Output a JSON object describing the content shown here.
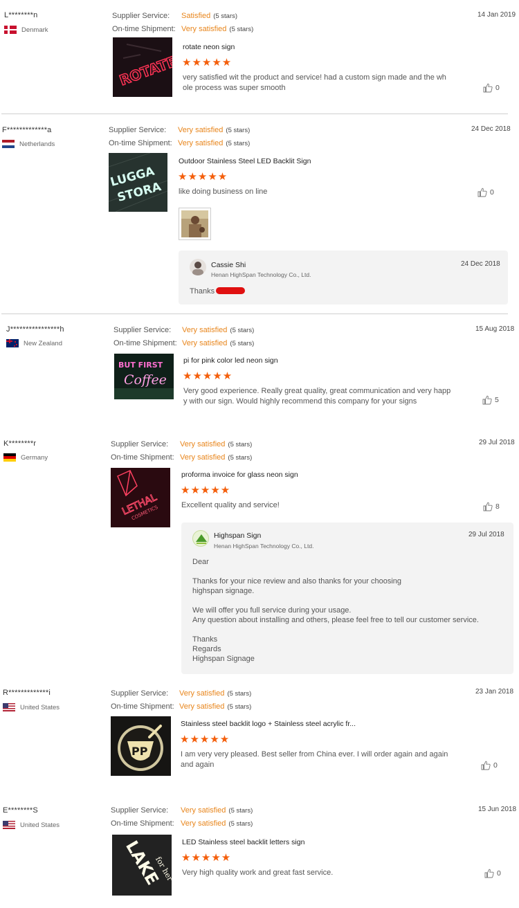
{
  "labels": {
    "supplier_service": "Supplier Service:",
    "ontime_shipment": "On-time Shipment:",
    "stars_note": "(5 stars)"
  },
  "colors": {
    "accent": "#e8851b",
    "star": "#f45f0c",
    "reply_bg": "#f3f3f3"
  },
  "reviews": [
    {
      "user": "L********n",
      "country": "Denmark",
      "flag": "denmark-flag",
      "supplier_rating": "Satisfied",
      "shipment_rating": "Very satisfied",
      "date": "14 Jan 2019",
      "title": "rotate neon sign",
      "stars": "★★★★★",
      "text": "very satisfied wit the product and service! had a custom sign made and the wh ole process was super smooth",
      "likes": "0"
    },
    {
      "user": "F*************a",
      "country": "Netherlands",
      "flag": "netherlands-flag",
      "supplier_rating": "Very satisfied",
      "shipment_rating": "Very satisfied",
      "date": "24 Dec 2018",
      "title": "Outdoor Stainless Steel LED Backlit Sign",
      "stars": "★★★★★",
      "text": "like doing business on line",
      "likes": "0",
      "reply": {
        "name": "Cassie Shi",
        "company": "Henan HighSpan Technology Co., Ltd.",
        "date": "24 Dec 2018",
        "text": "Thanks"
      }
    },
    {
      "user": "J****************h",
      "country": "New Zealand",
      "flag": "new-zealand-flag",
      "supplier_rating": "Very satisfied",
      "shipment_rating": "Very satisfied",
      "date": "15 Aug 2018",
      "title": "pi for pink color led neon sign",
      "stars": "★★★★★",
      "text": "Very good experience. Really great quality, great communication and very happ y with our sign. Would highly recommend this company for your signs",
      "likes": "5"
    },
    {
      "user": "K********r",
      "country": "Germany",
      "flag": "germany-flag",
      "supplier_rating": "Very satisfied",
      "shipment_rating": "Very satisfied",
      "date": "29 Jul 2018",
      "title": "proforma invoice for glass neon sign",
      "stars": "★★★★★",
      "text": "Excellent quality and service!",
      "likes": "8",
      "reply": {
        "name": "Highspan Sign",
        "company": "Henan HighSpan Technology Co., Ltd.",
        "date": "29 Jul 2018",
        "text": "Dear \n\nThanks for your nice review and also thanks for your choosing\nhighspan signage.\n\nWe will offer you full service during your usage.\nAny question about installing and others, please feel free to tell our customer service.\n\nThanks\nRegards\nHighspan Signage"
      }
    },
    {
      "user": "R*************i",
      "country": "United States",
      "flag": "united-states-flag",
      "supplier_rating": "Very satisfied",
      "shipment_rating": "Very satisfied",
      "date": "23 Jan 2018",
      "title": "Stainless steel backlit logo + Stainless steel acrylic fr...",
      "stars": "★★★★★",
      "text": "I am very very pleased. Best seller from China ever. I will order again and again and again",
      "likes": "0"
    },
    {
      "user": "E********S",
      "country": "United States",
      "flag": "united-states-flag",
      "supplier_rating": "Very satisfied",
      "shipment_rating": "Very satisfied",
      "date": "15 Jun 2018",
      "title": "LED Stainless steel backlit letters sign",
      "stars": "★★★★★",
      "text": "Very high quality work and great fast service.",
      "likes": "0"
    }
  ]
}
